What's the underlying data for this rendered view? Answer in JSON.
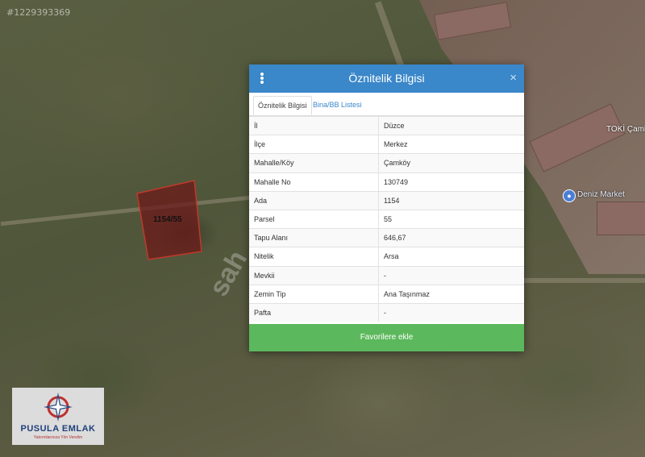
{
  "image_id": "#1229393369",
  "map": {
    "parcel_label": "1154/55",
    "toki_label": "TOKİ Çamk",
    "market_label": "Deniz Market",
    "watermark": "sah"
  },
  "dialog": {
    "title": "Öznitelik Bilgisi",
    "close": "×",
    "tabs": [
      {
        "label": "Öznitelik Bilgisi",
        "active": true
      },
      {
        "label": "Bina/BB Listesi",
        "active": false
      }
    ],
    "rows": [
      {
        "key": "İl",
        "value": "Düzce"
      },
      {
        "key": "İlçe",
        "value": "Merkez"
      },
      {
        "key": "Mahalle/Köy",
        "value": "Çamköy"
      },
      {
        "key": "Mahalle No",
        "value": "130749"
      },
      {
        "key": "Ada",
        "value": "1154"
      },
      {
        "key": "Parsel",
        "value": "55"
      },
      {
        "key": "Tapu Alanı",
        "value": "646,67"
      },
      {
        "key": "Nitelik",
        "value": "Arsa"
      },
      {
        "key": "Mevkii",
        "value": "-"
      },
      {
        "key": "Zemin Tip",
        "value": "Ana Taşınmaz"
      },
      {
        "key": "Pafta",
        "value": "-"
      }
    ],
    "favorite_button": "Favorilere ekle"
  },
  "logo": {
    "name": "PUSULA EMLAK",
    "tagline": "Yatırımlarınıza Yön Verelim"
  },
  "colors": {
    "header": "#3a87c9",
    "button": "#5cb85c",
    "parcel_fill": "#6b1a1a",
    "parcel_stroke": "#c0392b"
  }
}
